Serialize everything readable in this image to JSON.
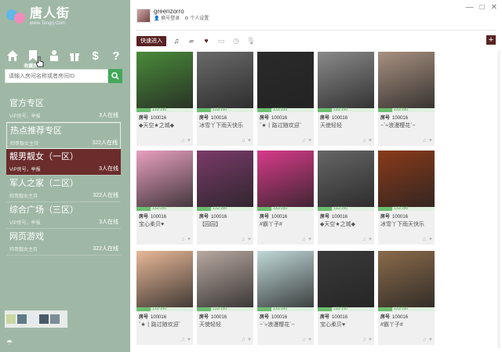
{
  "app": {
    "logo_text": "唐人街",
    "logo_url": "www.Tangrj.Com"
  },
  "nav": {
    "items": [
      {
        "name": "home-icon",
        "label": ""
      },
      {
        "name": "bookmark-icon",
        "label": "收藏房间"
      },
      {
        "name": "user-icon",
        "label": ""
      },
      {
        "name": "gift-icon",
        "label": ""
      },
      {
        "name": "dollar-icon",
        "label": ""
      },
      {
        "name": "help-icon",
        "label": ""
      }
    ],
    "search_placeholder": "请输入房间名称或者房间ID"
  },
  "zones": [
    {
      "name": "官方专区",
      "host": "VIP房号，举报",
      "count": "3人在线",
      "state": "normal"
    },
    {
      "name": "热点推荐专区",
      "host": "帅哥靓女主持",
      "count": "322人在线",
      "state": "hover"
    },
    {
      "name": "靓男靓女（一区）",
      "host": "VIP房号，举报",
      "count": "3人在线",
      "state": "active"
    },
    {
      "name": "军人之家（二区）",
      "host": "帅哥靓女主持",
      "count": "322人在线",
      "state": "normal"
    },
    {
      "name": "综合广场（三区）",
      "host": "VIP房号，举报",
      "count": "3人在线",
      "state": "normal"
    },
    {
      "name": "网页游戏",
      "host": "帅哥靓女主持",
      "count": "322人在线",
      "state": "normal"
    }
  ],
  "user": {
    "name": "greenzorro",
    "link_switch": "换号登录",
    "link_settings": "个人设置"
  },
  "toolbar": {
    "quick_enter": "快速进入",
    "add_label": "+"
  },
  "window_controls": {
    "minimize": "—",
    "maximize": "□",
    "close": "✕"
  },
  "colors": {
    "sidebar_bg": "#9fb8a5",
    "accent": "#5a2323",
    "active_zone": "#6b2c2c",
    "search_btn": "#43a85a"
  },
  "cards": [
    {
      "id": "100016",
      "capacity": "132/150",
      "title": "◆天空★之城◆",
      "color": "#4a8a3a"
    },
    {
      "id": "100016",
      "capacity": "132/150",
      "title": "冰雪丫下雨天快乐",
      "color": "#6a6a6a"
    },
    {
      "id": "100016",
      "capacity": "132/150",
      "title": "ˇ★丨路过随欢迎ˇ",
      "color": "#2a2a2a"
    },
    {
      "id": "100016",
      "capacity": "132/150",
      "title": "天使轻轻",
      "color": "#8a8a8a"
    },
    {
      "id": "100016",
      "capacity": "132/150",
      "title": "~ˋ≈浪漫樱花ˋ~",
      "color": "#a89080"
    },
    {
      "id": "100016",
      "capacity": "132/150",
      "title": "宝心柔贝♥",
      "color": "#e8a0c0"
    },
    {
      "id": "100016",
      "capacity": "132/150",
      "title": "【园园】",
      "color": "#7a3a6a"
    },
    {
      "id": "100016",
      "capacity": "132/150",
      "title": "#霸丫子#",
      "color": "#d83a8a"
    },
    {
      "id": "100016",
      "capacity": "132/150",
      "title": "◆天空★之城◆",
      "color": "#666666"
    },
    {
      "id": "100016",
      "capacity": "132/150",
      "title": "冰雪丫下雨天快乐",
      "color": "#8a3a1a"
    },
    {
      "id": "100016",
      "capacity": "132/150",
      "title": "ˇ★丨路过随欢迎ˇ",
      "color": "#e8b898"
    },
    {
      "id": "100016",
      "capacity": "132/150",
      "title": "天使轻轻",
      "color": "#b8a8a0"
    },
    {
      "id": "100016",
      "capacity": "132/150",
      "title": "~ˋ≈浪漫樱花ˋ~",
      "color": "#c0d8d8"
    },
    {
      "id": "100016",
      "capacity": "132/150",
      "title": "宝心柔贝♥",
      "color": "#3a3a3a"
    },
    {
      "id": "100016",
      "capacity": "132/150",
      "title": "#霸丫子#",
      "color": "#8a6a4a"
    }
  ],
  "card_id_prefix": "房号"
}
